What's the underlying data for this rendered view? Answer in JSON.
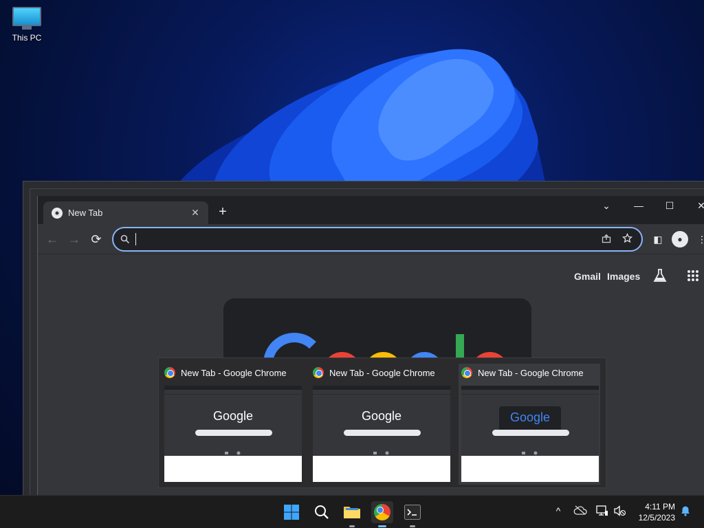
{
  "desktop": {
    "icons": [
      {
        "label": "This PC",
        "icon": "this-pc-icon"
      }
    ]
  },
  "browser": {
    "tab": {
      "title": "New Tab",
      "close_glyph": "✕"
    },
    "new_tab_glyph": "+",
    "window_controls": {
      "search_tabs": "⌄",
      "minimize": "—",
      "maximize": "☐",
      "close": "✕"
    },
    "toolbar": {
      "back": "←",
      "forward": "→",
      "reload": "⟳",
      "side_panel": "◧",
      "menu": "⋮"
    },
    "omnibox": {
      "value": "",
      "placeholder": ""
    },
    "ntp": {
      "gmail": "Gmail",
      "images": "Images",
      "labs_icon": "flask-icon",
      "apps_icon": "apps-grid-icon"
    }
  },
  "preview_flyout": {
    "items": [
      {
        "title": "New Tab - Google Chrome",
        "thumb_text": "Google"
      },
      {
        "title": "New Tab - Google Chrome",
        "thumb_text": "Google"
      },
      {
        "title": "New Tab - Google Chrome",
        "thumb_text": "Google"
      }
    ]
  },
  "taskbar": {
    "apps": [
      "start",
      "search",
      "file-explorer",
      "chrome",
      "terminal"
    ],
    "tray_overflow": "^",
    "clock": {
      "time": "4:11 PM",
      "date": "12/5/2023"
    }
  },
  "colors": {
    "accent": "#8ab4f8",
    "taskbar": "#1c1c1c",
    "chrome_dark": "#35363a"
  }
}
